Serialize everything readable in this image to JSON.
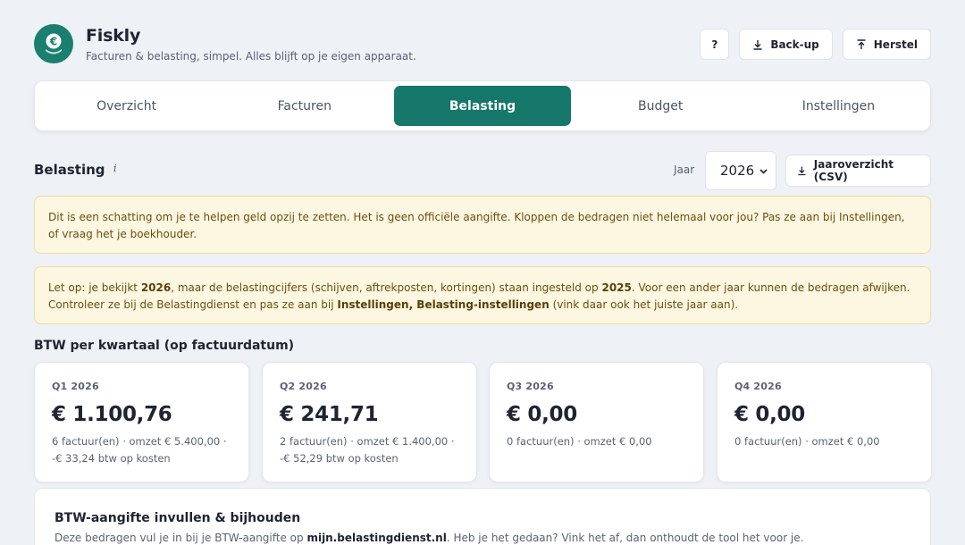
{
  "app": {
    "name": "Fiskly",
    "tagline": "Facturen & belasting, simpel. Alles blijft op je eigen apparaat.",
    "logo_icon": "euro-coin-icon",
    "brand_color": "#16786a"
  },
  "header": {
    "help_label": "?",
    "backup_label": "Back-up",
    "restore_label": "Herstel"
  },
  "tabs": [
    {
      "label": "Overzicht",
      "active": false
    },
    {
      "label": "Facturen",
      "active": false
    },
    {
      "label": "Belasting",
      "active": true
    },
    {
      "label": "Budget",
      "active": false
    },
    {
      "label": "Instellingen",
      "active": false
    }
  ],
  "section": {
    "title": "Belasting",
    "info": "i",
    "year_label": "Jaar",
    "year_value": "2026",
    "csv_label": "Jaaroverzicht (CSV)"
  },
  "notice1": {
    "text": "Dit is een schatting om je te helpen geld opzij te zetten. Het is geen officiële aangifte. Kloppen de bedragen niet helemaal voor jou? Pas ze aan bij Instellingen, of vraag het je boekhouder."
  },
  "notice2": {
    "t1": "Let op: je bekijkt ",
    "b1": "2026",
    "t2": ", maar de belastingcijfers (schijven, aftrekposten, kortingen) staan ingesteld op ",
    "b2": "2025",
    "t3": ". Voor een ander jaar kunnen de bedragen afwijken. Controleer ze bij de Belastingdienst en pas ze aan bij ",
    "b3": "Instellingen, Belasting-instellingen",
    "t4": " (vink daar ook het juiste jaar aan)."
  },
  "btw": {
    "title": "BTW per kwartaal (op factuurdatum)",
    "quarters": [
      {
        "label": "Q1 2026",
        "amount": "€ 1.100,76",
        "meta": "6 factuur(en) · omzet € 5.400,00 · -€ 33,24 btw op kosten"
      },
      {
        "label": "Q2 2026",
        "amount": "€ 241,71",
        "meta": "2 factuur(en) · omzet € 1.400,00 · -€ 52,29 btw op kosten"
      },
      {
        "label": "Q3 2026",
        "amount": "€ 0,00",
        "meta": "0 factuur(en) · omzet € 0,00"
      },
      {
        "label": "Q4 2026",
        "amount": "€ 0,00",
        "meta": "0 factuur(en) · omzet € 0,00"
      }
    ]
  },
  "panel": {
    "title": "BTW-aangifte invullen & bijhouden",
    "d1": "Deze bedragen vul je in bij je BTW-aangifte op ",
    "link": "mijn.belastingdienst.nl",
    "d2": ". Heb je het gedaan? Vink het af, dan onthoudt de tool het voor je."
  }
}
